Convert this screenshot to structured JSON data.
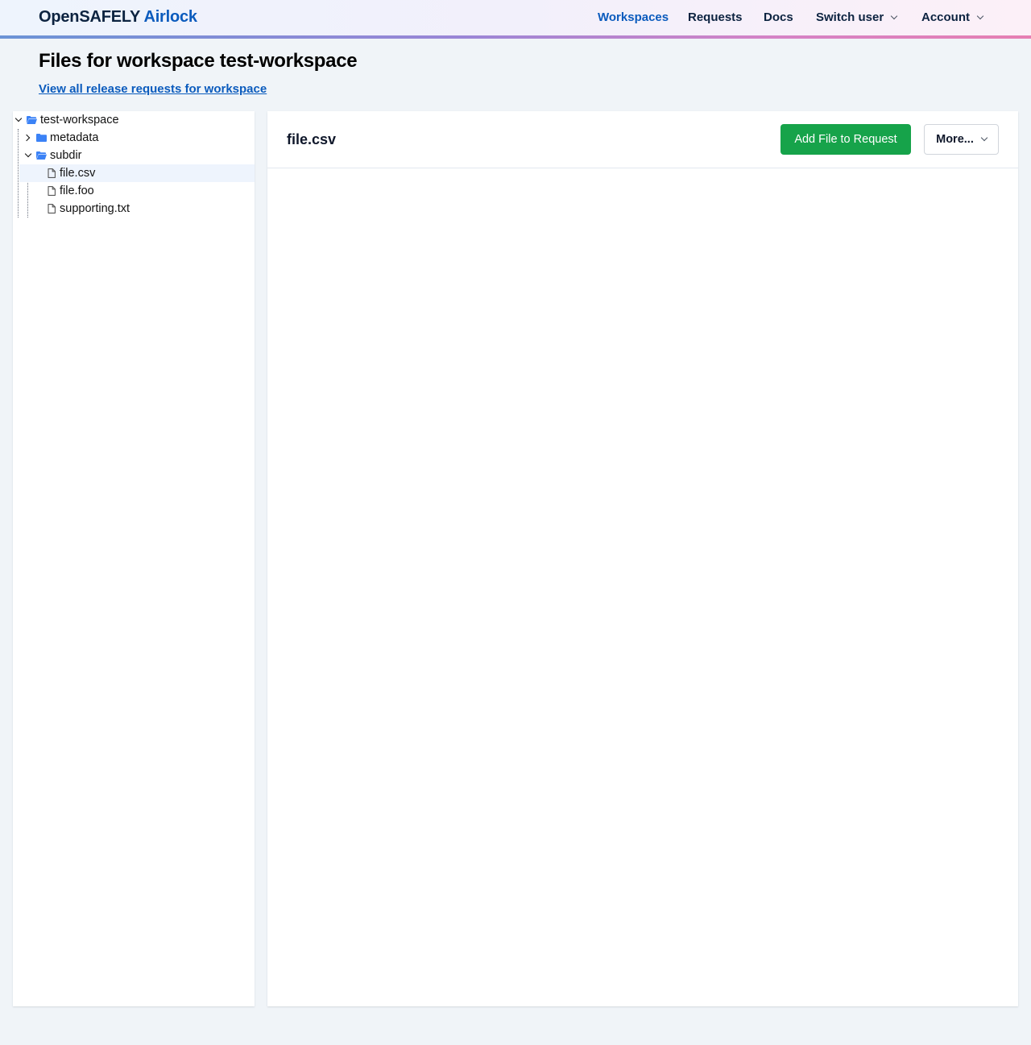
{
  "header": {
    "brand_primary": "OpenSAFELY",
    "brand_secondary": "Airlock",
    "nav": [
      {
        "label": "Workspaces",
        "active": true,
        "dropdown": false
      },
      {
        "label": "Requests",
        "active": false,
        "dropdown": false
      },
      {
        "label": "Docs",
        "active": false,
        "dropdown": false
      },
      {
        "label": "Switch user",
        "active": false,
        "dropdown": true
      },
      {
        "label": "Account",
        "active": false,
        "dropdown": true
      }
    ]
  },
  "page": {
    "title": "Files for workspace test-workspace",
    "link": "View all release requests for workspace"
  },
  "tree": {
    "items": [
      {
        "label": "test-workspace",
        "type": "folder",
        "expanded": true,
        "depth": 0
      },
      {
        "label": "metadata",
        "type": "folder",
        "expanded": false,
        "depth": 1
      },
      {
        "label": "subdir",
        "type": "folder",
        "expanded": true,
        "depth": 1
      },
      {
        "label": "file.csv",
        "type": "file",
        "depth": 2,
        "selected": true
      },
      {
        "label": "file.foo",
        "type": "file",
        "depth": 2,
        "selected": false
      },
      {
        "label": "supporting.txt",
        "type": "file",
        "depth": 2,
        "selected": false
      }
    ]
  },
  "content": {
    "title": "file.csv",
    "add_button": "Add File to Request",
    "more_button": "More..."
  },
  "colors": {
    "brand_dark": "#0c2340",
    "brand_blue": "#0b5bbd",
    "success_green": "#16a34a",
    "folder_blue": "#3b82f6",
    "selected_row": "#eef4fd",
    "page_bg": "#f0f4f8"
  }
}
